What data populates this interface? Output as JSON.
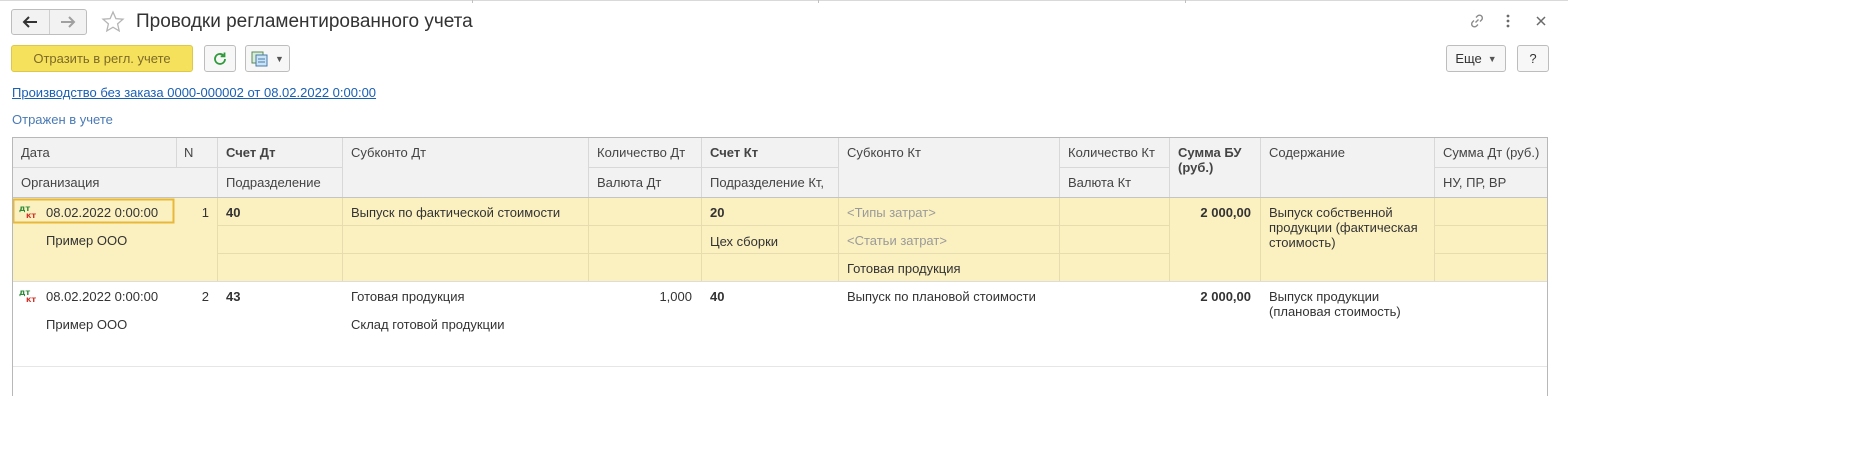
{
  "window": {
    "title": "Проводки регламентированного учета",
    "nav": {
      "back_icon": "arrow-left-icon",
      "forward_icon": "arrow-right-icon"
    },
    "favorite_icon": "star-icon",
    "link_icon": "link-icon",
    "more_icon": "more-vertical-icon",
    "close_icon": "close-icon"
  },
  "toolbar": {
    "reflect_label": "Отразить в регл. учете",
    "refresh_icon": "refresh-icon",
    "report_icon": "report-menu-icon",
    "more_label": "Еще",
    "help_label": "?"
  },
  "document_link": "Производство без заказа 0000-000002 от 08.02.2022 0:00:00",
  "status_text": "Отражен в учете",
  "table": {
    "headers": {
      "date": "Дата",
      "organization": "Организация",
      "n": "N",
      "account_dt": "Счет Дт",
      "subdivision": "Подразделение",
      "subconto_dt": "Субконто Дт",
      "qty_dt": "Количество Дт",
      "currency_dt": "Валюта Дт",
      "account_kt": "Счет Кт",
      "subdivision_kt": "Подразделение Кт,",
      "subconto_kt": "Субконто Кт",
      "qty_kt": "Количество Кт",
      "currency_kt": "Валюта Кт",
      "sum_bu": "Сумма БУ (руб.)",
      "content": "Содержание",
      "sum_dt": "Сумма Дт (руб.)",
      "nu_pr_vr": "НУ, ПР, ВР"
    },
    "rows": [
      {
        "icon": "dt-kt-icon",
        "date": "08.02.2022 0:00:00",
        "organization": "Пример ООО",
        "n": "1",
        "account_dt": "40",
        "subconto_dt": [
          "Выпуск по фактической стоимости",
          "",
          ""
        ],
        "qty_dt": "",
        "account_kt": "20",
        "subdivision_kt": "Цех сборки",
        "subconto_kt": [
          "<Типы затрат>",
          "<Статьи затрат>",
          "Готовая продукция"
        ],
        "sum_bu": "2 000,00",
        "content": "Выпуск собственной продукции (фактическая стоимость)",
        "selected": true
      },
      {
        "icon": "dt-kt-icon",
        "date": "08.02.2022 0:00:00",
        "organization": "Пример ООО",
        "n": "2",
        "account_dt": "43",
        "subconto_dt": [
          "Готовая продукция",
          "Склад готовой продукции",
          ""
        ],
        "qty_dt": "1,000",
        "account_kt": "40",
        "subdivision_kt": "",
        "subconto_kt": [
          "Выпуск по плановой стоимости",
          "",
          ""
        ],
        "sum_bu": "2 000,00",
        "content": "Выпуск продукции (плановая стоимость)",
        "selected": false
      }
    ]
  },
  "colors": {
    "primary_button": "#f5e15b",
    "selected_row": "#fbf0c0",
    "selected_cell_border": "#e8b83a",
    "link": "#1a5fb4",
    "header_bg": "#f2f2f2"
  }
}
